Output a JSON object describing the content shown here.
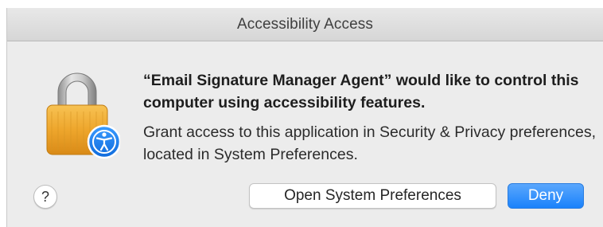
{
  "dialog": {
    "title": "Accessibility Access",
    "headline": "“Email Signature Manager Agent” would like to control this computer using accessibility features.",
    "body": "Grant access to this application in Security & Privacy preferences, located in System Preferences."
  },
  "buttons": {
    "help_label": "?",
    "open_prefs_label": "Open System Preferences",
    "deny_label": "Deny"
  },
  "icons": {
    "lock": "lock-icon",
    "accessibility_badge": "accessibility-icon"
  },
  "colors": {
    "accent": "#1a82fb",
    "lock_body": "#f0a830",
    "badge": "#1a7ef2"
  }
}
